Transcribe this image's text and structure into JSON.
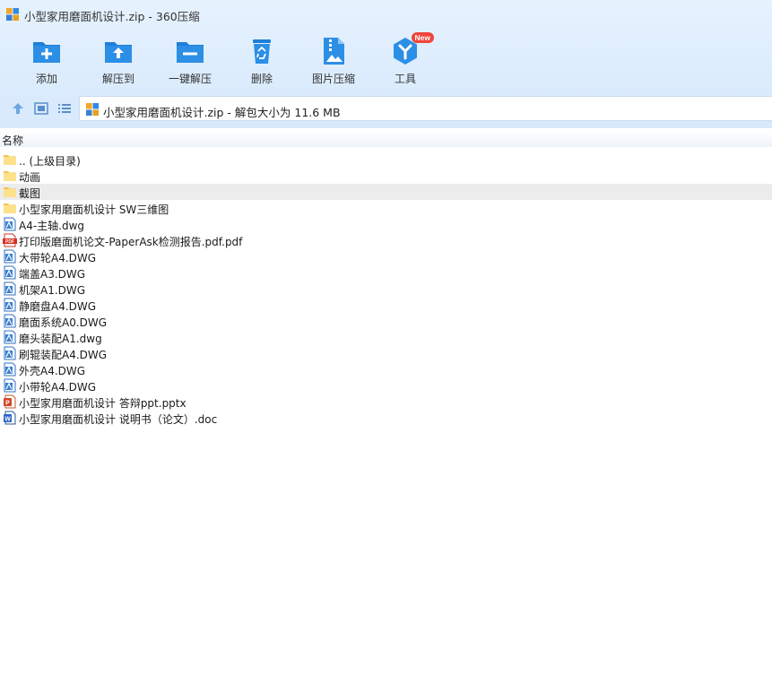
{
  "window": {
    "title": "小型家用磨面机设计.zip - 360压缩"
  },
  "toolbar": {
    "items": [
      {
        "label": "添加",
        "icon": "folder-add-icon"
      },
      {
        "label": "解压到",
        "icon": "folder-extract-icon"
      },
      {
        "label": "一键解压",
        "icon": "folder-oneclick-icon"
      },
      {
        "label": "删除",
        "icon": "recycle-bin-icon"
      },
      {
        "label": "图片压缩",
        "icon": "image-compress-icon"
      },
      {
        "label": "工具",
        "icon": "tools-icon",
        "badge": "New"
      }
    ]
  },
  "address": {
    "path": "小型家用磨面机设计.zip - 解包大小为 11.6 MB"
  },
  "columns": {
    "name": "名称"
  },
  "files": [
    {
      "name": ".. (上级目录)",
      "type": "folder"
    },
    {
      "name": "动画",
      "type": "folder"
    },
    {
      "name": "截图",
      "type": "folder",
      "selected": true
    },
    {
      "name": "小型家用磨面机设计 SW三维图",
      "type": "folder"
    },
    {
      "name": "A4-主轴.dwg",
      "type": "dwg"
    },
    {
      "name": "打印版磨面机论文-PaperAsk检测报告.pdf.pdf",
      "type": "pdf"
    },
    {
      "name": "大带轮A4.DWG",
      "type": "dwg"
    },
    {
      "name": "端盖A3.DWG",
      "type": "dwg"
    },
    {
      "name": "机架A1.DWG",
      "type": "dwg"
    },
    {
      "name": "静磨盘A4.DWG",
      "type": "dwg"
    },
    {
      "name": "磨面系统A0.DWG",
      "type": "dwg"
    },
    {
      "name": "磨头装配A1.dwg",
      "type": "dwg"
    },
    {
      "name": "刷辊装配A4.DWG",
      "type": "dwg"
    },
    {
      "name": "外壳A4.DWG",
      "type": "dwg"
    },
    {
      "name": "小带轮A4.DWG",
      "type": "dwg"
    },
    {
      "name": "小型家用磨面机设计 答辩ppt.pptx",
      "type": "pptx"
    },
    {
      "name": "小型家用磨面机设计 说明书（论文）.doc",
      "type": "doc"
    }
  ],
  "colors": {
    "accent": "#2c8fe6",
    "selected_row": "#ececec",
    "toolbar_bg": "#dcecfd"
  }
}
